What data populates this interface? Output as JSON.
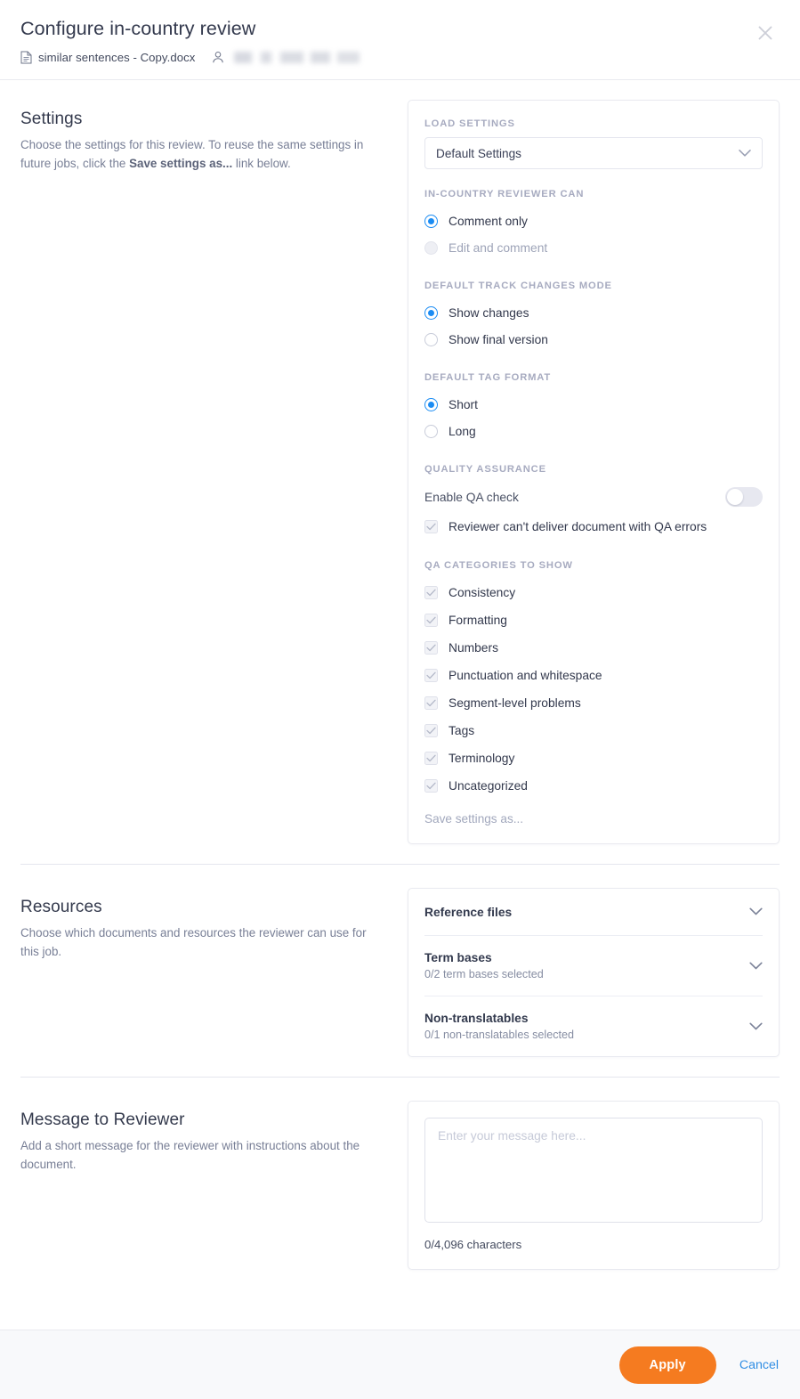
{
  "header": {
    "title": "Configure in-country review",
    "filename": "similar sentences - Copy.docx",
    "user_redacted": "",
    "doc_icon": "document-icon",
    "user_icon": "user-icon",
    "close_icon": "close-icon"
  },
  "settings": {
    "title": "Settings",
    "description_pre": "Choose the settings for this review. To reuse the same settings in future jobs, click the ",
    "description_bold": "Save settings as...",
    "description_post": " link below.",
    "load_settings_label": "LOAD SETTINGS",
    "load_settings_value": "Default Settings",
    "reviewer_can_label": "IN-COUNTRY REVIEWER CAN",
    "reviewer_can_options": [
      {
        "label": "Comment only",
        "checked": true,
        "disabled": false
      },
      {
        "label": "Edit and comment",
        "checked": false,
        "disabled": true
      }
    ],
    "track_changes_label": "DEFAULT TRACK CHANGES MODE",
    "track_changes_options": [
      {
        "label": "Show changes",
        "checked": true,
        "disabled": false
      },
      {
        "label": "Show final version",
        "checked": false,
        "disabled": false
      }
    ],
    "tag_format_label": "DEFAULT TAG FORMAT",
    "tag_format_options": [
      {
        "label": "Short",
        "checked": true,
        "disabled": false
      },
      {
        "label": "Long",
        "checked": false,
        "disabled": false
      }
    ],
    "qa_label": "QUALITY ASSURANCE",
    "qa_toggle_label": "Enable QA check",
    "qa_toggle_on": false,
    "qa_deliver_label": "Reviewer can't deliver document with QA errors",
    "qa_categories_label": "QA CATEGORIES TO SHOW",
    "qa_categories": [
      "Consistency",
      "Formatting",
      "Numbers",
      "Punctuation and whitespace",
      "Segment-level problems",
      "Tags",
      "Terminology",
      "Uncategorized"
    ],
    "save_settings_link": "Save settings as..."
  },
  "resources": {
    "title": "Resources",
    "description": "Choose which documents and resources the reviewer can use for this job.",
    "rows": [
      {
        "name": "Reference files",
        "sub": ""
      },
      {
        "name": "Term bases",
        "sub": "0/2 term bases selected"
      },
      {
        "name": "Non-translatables",
        "sub": "0/1 non-translatables selected"
      }
    ]
  },
  "message": {
    "title": "Message to Reviewer",
    "description": "Add a short message for the reviewer with instructions about the document.",
    "placeholder": "Enter your message here...",
    "value": "",
    "counter": "0/4,096 characters"
  },
  "footer": {
    "apply_label": "Apply",
    "cancel_label": "Cancel"
  },
  "colors": {
    "accent_orange": "#f57b20",
    "link_blue": "#2f8de4",
    "radio_blue": "#1b8cf3"
  }
}
